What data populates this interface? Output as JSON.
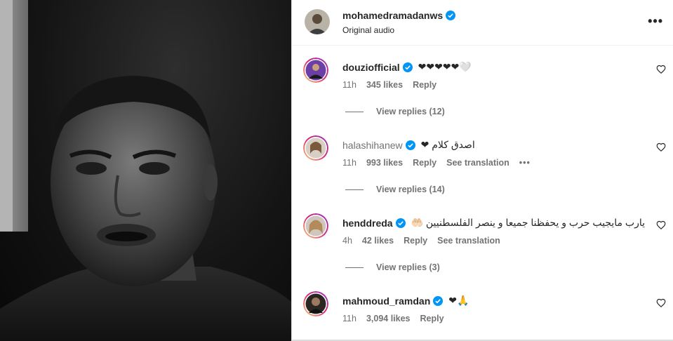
{
  "post": {
    "username": "mohamedramadanws",
    "subtitle": "Original audio",
    "more_icon": "more-horizontal-icon"
  },
  "comments": [
    {
      "username": "douziofficial",
      "verified": true,
      "text": "❤❤❤❤❤🤍",
      "time": "11h",
      "likes": "345 likes",
      "reply": "Reply",
      "translation": "",
      "replies": "View replies (12)"
    },
    {
      "username": "halashihanew",
      "verified": true,
      "text": "اصدق كلام ❤",
      "time": "11h",
      "likes": "993 likes",
      "reply": "Reply",
      "translation": "See translation",
      "replies": "View replies (14)"
    },
    {
      "username": "henddreda",
      "verified": true,
      "text": "يارب مايجيب حرب و يحفظنا جميعا و ينصر الفلسطنيين 🤲🏻",
      "time": "4h",
      "likes": "42 likes",
      "reply": "Reply",
      "translation": "See translation",
      "replies": "View replies (3)"
    },
    {
      "username": "mahmoud_ramdan",
      "verified": true,
      "text": "❤🙏",
      "time": "11h",
      "likes": "3,094 likes",
      "reply": "Reply",
      "translation": "",
      "replies": ""
    }
  ],
  "colors": {
    "verified": "#0095f6",
    "secondary_text": "#737373",
    "primary_text": "#262626",
    "border": "#dbdbdb"
  }
}
